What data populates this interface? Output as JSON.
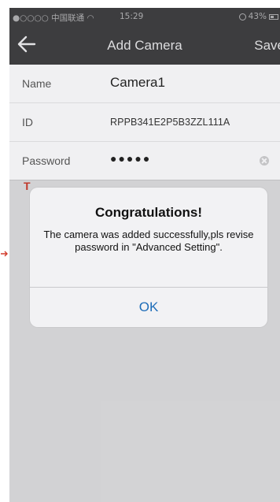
{
  "status_bar": {
    "carrier": "●○○○○ 中国联通 ",
    "time": "15:29",
    "battery": "43%"
  },
  "nav": {
    "title": "Add Camera",
    "save_label": "Save"
  },
  "form": {
    "name_label": "Name",
    "name_value": "Camera1",
    "id_label": "ID",
    "id_value": "RPPB341E2P5B3ZZL111A",
    "password_label": "Password",
    "password_value": "●●●●●",
    "hidden_label_start": "T"
  },
  "alert": {
    "title": "Congratulations!",
    "message": "The camera was added successfully,pls revise password in \"Advanced Setting\".",
    "ok_label": "OK"
  },
  "colors": {
    "bar_bg": "#3d3d3f",
    "alert_button": "#1e6db8",
    "accent_red": "#c0392b"
  }
}
